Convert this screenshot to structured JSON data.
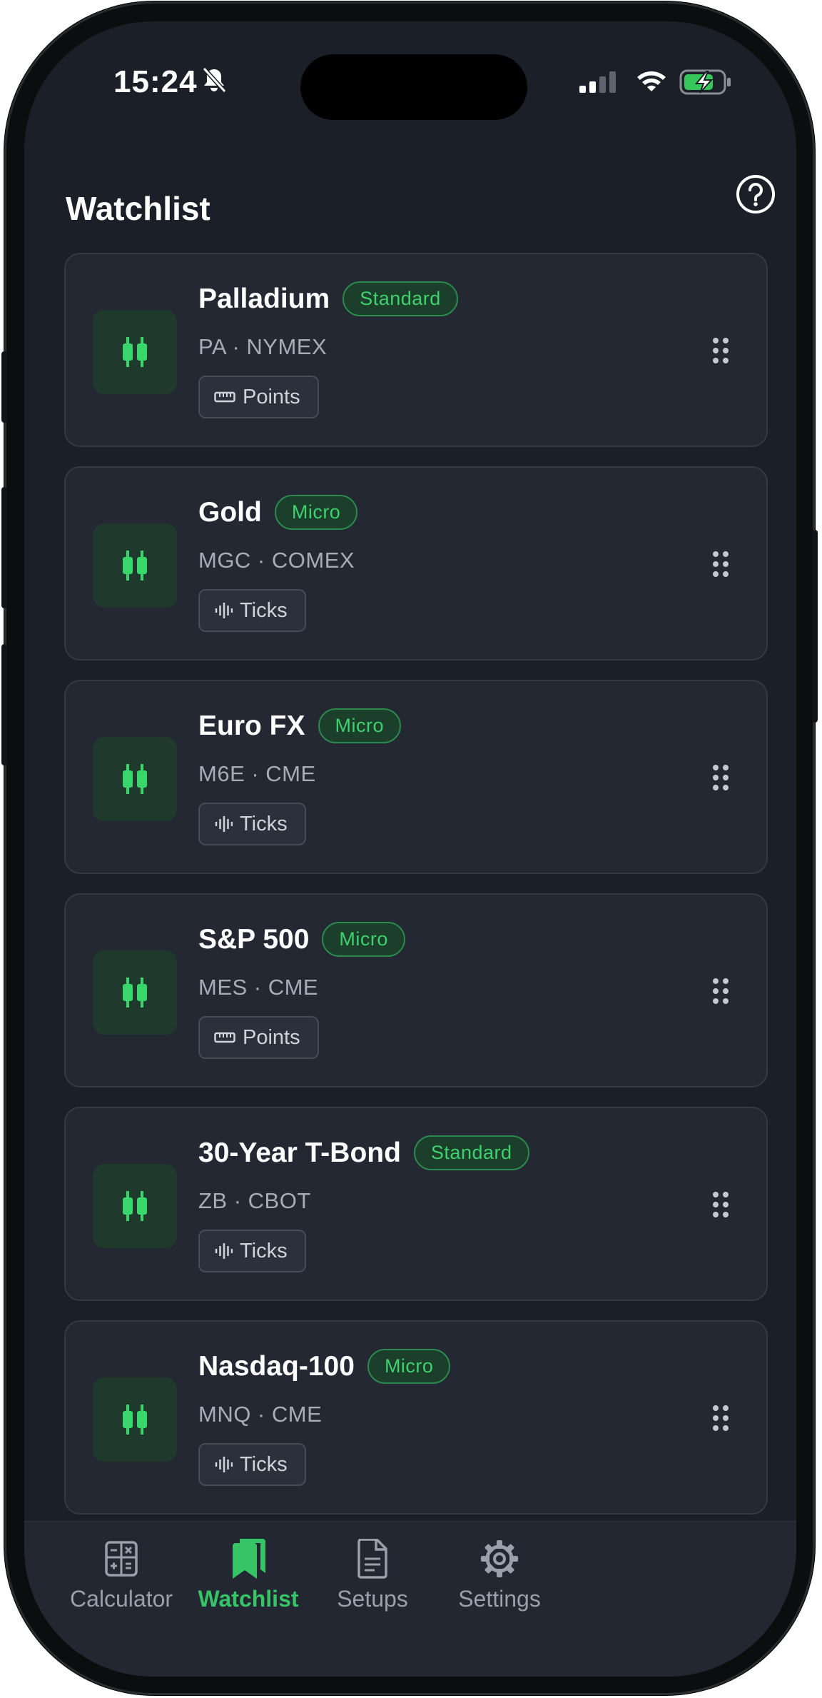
{
  "status_bar": {
    "time": "15:24"
  },
  "header": {
    "title": "Watchlist"
  },
  "colors": {
    "accent": "#36c466",
    "background": "#1b1f27",
    "card": "#232833"
  },
  "watchlist": [
    {
      "name": "Palladium",
      "badge": "Standard",
      "symbol_exchange": "PA · NYMEX",
      "unit": "Points",
      "unit_icon": "ruler-icon"
    },
    {
      "name": "Gold",
      "badge": "Micro",
      "symbol_exchange": "MGC · COMEX",
      "unit": "Ticks",
      "unit_icon": "ticks-icon"
    },
    {
      "name": "Euro FX",
      "badge": "Micro",
      "symbol_exchange": "M6E · CME",
      "unit": "Ticks",
      "unit_icon": "ticks-icon"
    },
    {
      "name": "S&P 500",
      "badge": "Micro",
      "symbol_exchange": "MES · CME",
      "unit": "Points",
      "unit_icon": "ruler-icon"
    },
    {
      "name": "30-Year T-Bond",
      "badge": "Standard",
      "symbol_exchange": "ZB · CBOT",
      "unit": "Ticks",
      "unit_icon": "ticks-icon"
    },
    {
      "name": "Nasdaq-100",
      "badge": "Micro",
      "symbol_exchange": "MNQ · CME",
      "unit": "Ticks",
      "unit_icon": "ticks-icon"
    }
  ],
  "tabs": [
    {
      "label": "Calculator",
      "icon": "calculator-icon",
      "active": false
    },
    {
      "label": "Watchlist",
      "icon": "bookmarks-icon",
      "active": true
    },
    {
      "label": "Setups",
      "icon": "document-icon",
      "active": false
    },
    {
      "label": "Settings",
      "icon": "gear-icon",
      "active": false
    }
  ]
}
